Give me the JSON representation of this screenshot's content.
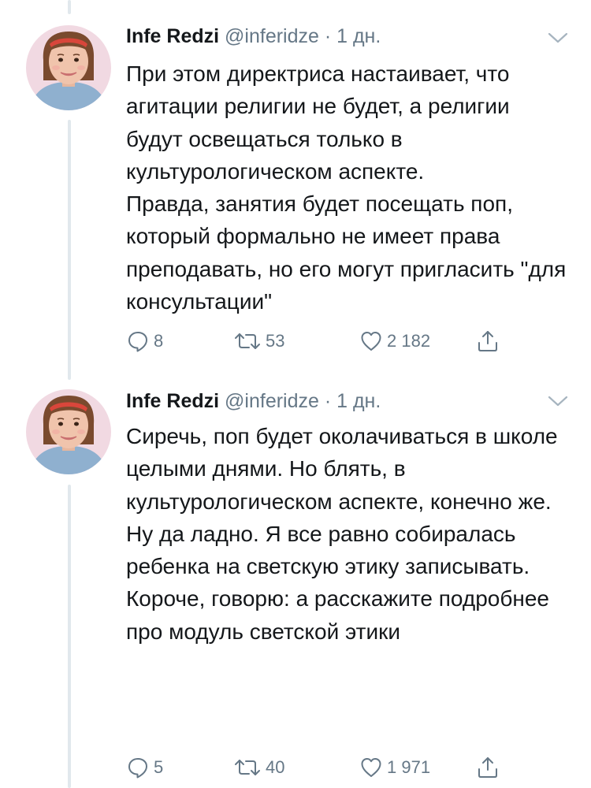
{
  "tweets": [
    {
      "author_name": "Infe Redzi",
      "handle": "@inferidze",
      "separator": " · ",
      "time": "1 дн.",
      "text_lines": [
        "При этом директриса настаивает, что агитации религии не будет, а религии будут освещаться только в культурологическом аспекте.",
        "Правда, занятия будет посещать поп, который формально не имеет права преподавать, но его могут пригласить \"для консультации\""
      ],
      "replies": "8",
      "retweets": "53",
      "likes": "2 182"
    },
    {
      "author_name": "Infe Redzi",
      "handle": "@inferidze",
      "separator": " · ",
      "time": "1 дн.",
      "text_lines": [
        "Сиречь, поп будет околачиваться в школе целыми днями. Но блять, в культурологическом аспекте, конечно же.",
        "Ну да ладно. Я все равно собиралась ребенка на светскую этику записывать.",
        "Короче, говорю: а расскажите подробнее про модуль светской этики"
      ],
      "replies": "5",
      "retweets": "40",
      "likes": "1 971"
    }
  ],
  "icons": {
    "reply": "reply-icon",
    "retweet": "retweet-icon",
    "like": "like-icon",
    "share": "share-icon",
    "more": "chevron-down-icon"
  },
  "colors": {
    "text": "#14171a",
    "secondary": "#657786",
    "thread_line": "#e1e8ed",
    "avatar_bg": "#f1d9e2"
  }
}
